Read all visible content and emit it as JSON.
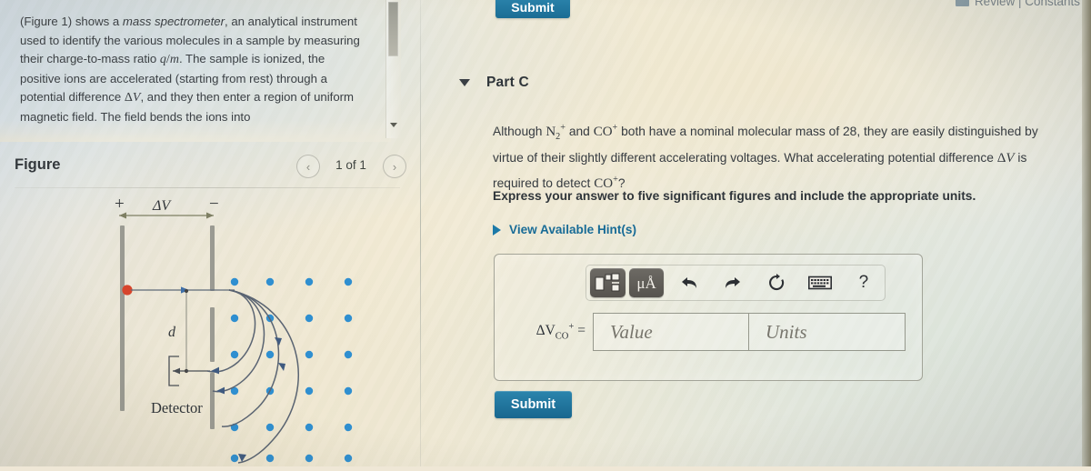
{
  "left_panel": {
    "problem_text_lines": [
      "(Figure 1) shows a mass spectrometer, an analytical",
      "instrument used to identify the various molecules in a",
      "sample by measuring their charge-to-mass ratio q/m.",
      "The sample is ionized, the positive ions are",
      "accelerated (starting from rest) through a potential",
      "difference ΔV, and they then enter a region of",
      "uniform magnetic field. The field bends the ions into"
    ],
    "figure_title": "Figure",
    "figure_count": "1 of 1",
    "prev_arrow": "‹",
    "next_arrow": "›"
  },
  "figure": {
    "plus_label": "+",
    "minus_label": "−",
    "delta_v_label": "ΔV",
    "d_label": "d",
    "detector_label": "Detector",
    "field_dot_color": "#2f8fd0",
    "source_dot_color": "#d7452c",
    "plate_color": "#9a9a92",
    "trajectory_color": "#5a6472",
    "dot_rows": 6,
    "dot_cols": 4
  },
  "right_panel": {
    "top_submit_label": "Submit",
    "review_constants_label": "Review | Constants",
    "part_label": "Part C",
    "question_lines": [
      "Although N2+ and CO+ both have a nominal molecular mass of 28, they are easily",
      "distinguished by virtue of their slightly different accelerating voltages. What accelerating",
      "potential difference ΔV is required to detect CO+ ?"
    ],
    "express_instruction": "Express your answer to five significant figures and include the appropriate units.",
    "hints_label": "View Available Hint(s)",
    "submit_label": "Submit",
    "accent_color": "#1b6d94",
    "link_color": "#186b96"
  },
  "answer_area": {
    "label_prefix": "ΔV",
    "label_sub": "CO",
    "label_sup": "+",
    "label_equals": "=",
    "value_placeholder": "Value",
    "units_placeholder": "Units",
    "toolbar": {
      "template_button": "math-template",
      "units_button": "μÅ",
      "undo": "↶",
      "redo": "↷",
      "reset": "↻",
      "keyboard": "keyboard",
      "help": "?"
    }
  }
}
